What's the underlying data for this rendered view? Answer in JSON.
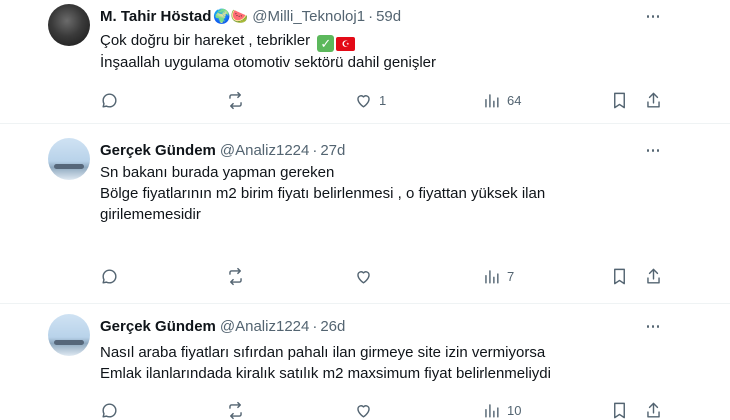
{
  "tweets": [
    {
      "name": "M. Tahir Höstad",
      "name_emojis": "🌍🍉",
      "handle": "@Milli_Teknoloj1",
      "time": "59d",
      "lines": [
        "Çok doğru bir hareket , tebrikler",
        "İnşaallah uygulama otomotiv sektörü dahil genişler"
      ],
      "line1_emojis": {
        "check": "✓",
        "flag": "☪"
      },
      "reply_count": "",
      "repost_count": "",
      "like_count": "1",
      "view_count": "64"
    },
    {
      "name": "Gerçek Gündem",
      "handle": "@Analiz1224",
      "time": "27d",
      "lines": [
        "Sn bakanı  burada yapman gereken",
        "Bölge fiyatlarının m2 birim fiyatı belirlenmesi ,  o fiyattan yüksek ilan",
        "girilememesidir"
      ],
      "reply_count": "",
      "repost_count": "",
      "like_count": "",
      "view_count": "7"
    },
    {
      "name": "Gerçek Gündem",
      "handle": "@Analiz1224",
      "time": "26d",
      "lines": [
        "Nasıl araba fiyatları sıfırdan pahalı ilan girmeye site izin vermiyorsa",
        "Emlak ilanlarındada kiralık satılık m2 maxsimum fiyat belirlenmeliydi"
      ],
      "reply_count": "",
      "repost_count": "",
      "like_count": "",
      "view_count": "10"
    }
  ],
  "separator_dot": "·",
  "icons": [
    "reply-icon",
    "repost-icon",
    "like-icon",
    "views-icon",
    "bookmark-icon",
    "share-icon",
    "more-icon"
  ]
}
